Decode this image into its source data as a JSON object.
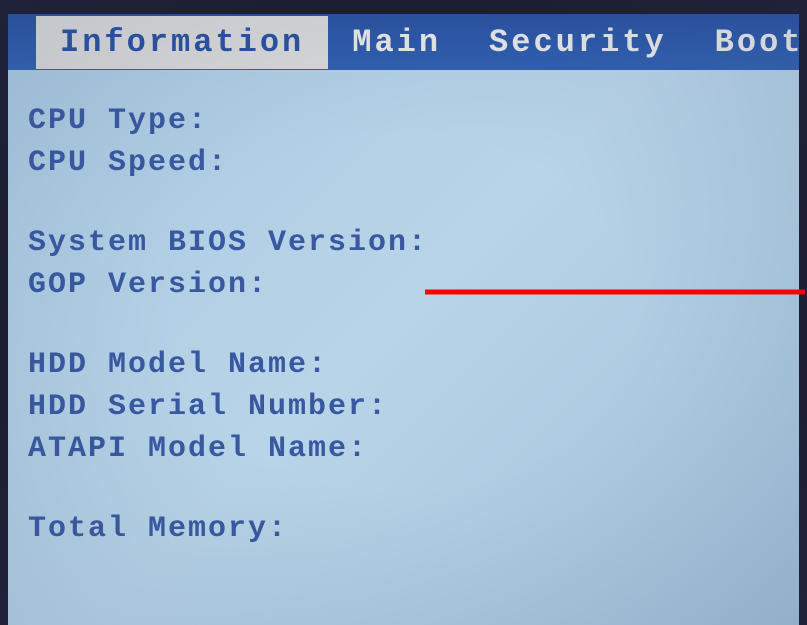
{
  "menu": {
    "tabs": [
      {
        "label": "Information",
        "active": true
      },
      {
        "label": "Main",
        "active": false
      },
      {
        "label": "Security",
        "active": false
      },
      {
        "label": "Boot",
        "active": false
      }
    ]
  },
  "info": {
    "group1": [
      {
        "label": "CPU Type:"
      },
      {
        "label": "CPU Speed:"
      }
    ],
    "group2": [
      {
        "label": "System BIOS Version:",
        "annotated": true
      },
      {
        "label": "GOP Version:"
      }
    ],
    "group3": [
      {
        "label": "HDD Model Name:"
      },
      {
        "label": "HDD Serial Number:"
      },
      {
        "label": "ATAPI Model Name:"
      }
    ],
    "group4": [
      {
        "label": "Total Memory:"
      }
    ]
  },
  "annotation": {
    "color": "#ff0000"
  }
}
